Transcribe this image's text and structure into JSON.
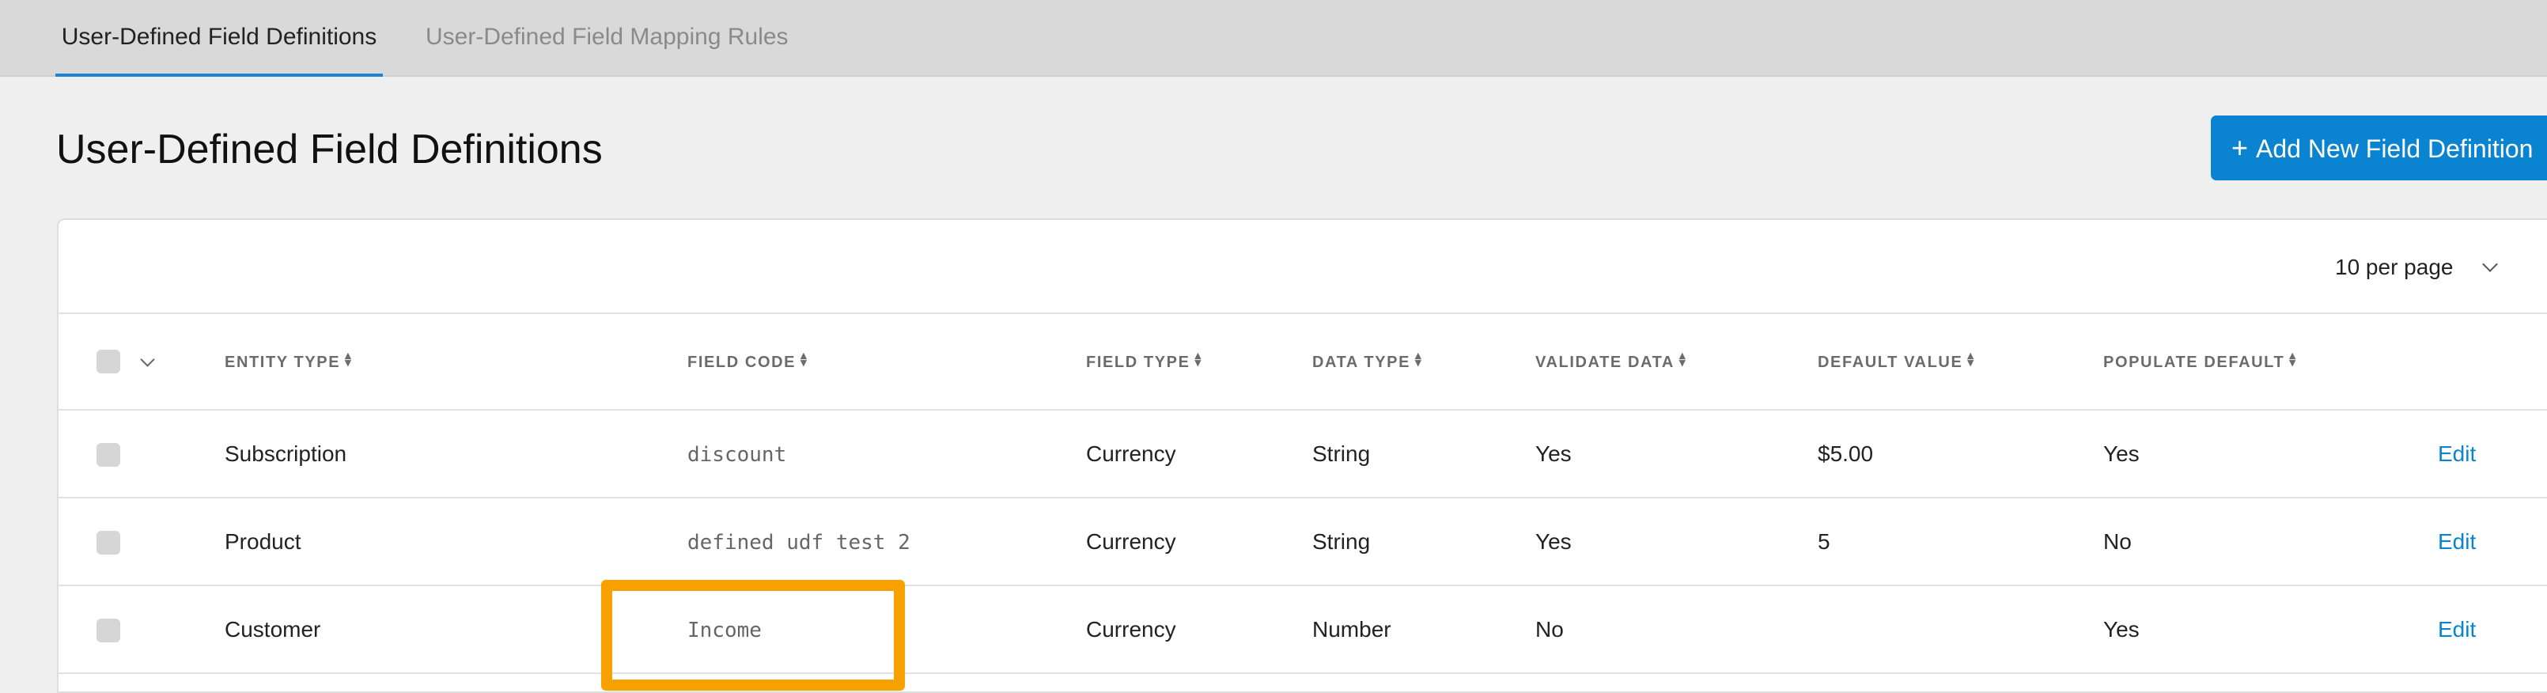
{
  "tabs": [
    {
      "label": "User-Defined Field Definitions",
      "active": true
    },
    {
      "label": "User-Defined Field Mapping Rules",
      "active": false
    }
  ],
  "page": {
    "title": "User-Defined Field Definitions",
    "add_button_label": "Add New Field Definition"
  },
  "pagination": {
    "per_page_label": "10 per page"
  },
  "table": {
    "columns": [
      "ENTITY TYPE",
      "FIELD CODE",
      "FIELD TYPE",
      "DATA TYPE",
      "VALIDATE DATA",
      "DEFAULT VALUE",
      "POPULATE DEFAULT"
    ],
    "rows": [
      {
        "entity_type": "Subscription",
        "field_code": "discount",
        "field_type": "Currency",
        "data_type": "String",
        "validate_data": "Yes",
        "default_value": "$5.00",
        "populate_default": "Yes",
        "action": "Edit"
      },
      {
        "entity_type": "Product",
        "field_code": "defined udf test 2",
        "field_type": "Currency",
        "data_type": "String",
        "validate_data": "Yes",
        "default_value": "5",
        "populate_default": "No",
        "action": "Edit"
      },
      {
        "entity_type": "Customer",
        "field_code": "Income",
        "field_type": "Currency",
        "data_type": "Number",
        "validate_data": "No",
        "default_value": "",
        "populate_default": "Yes",
        "action": "Edit"
      }
    ]
  },
  "colors": {
    "accent": "#0a84d0",
    "highlight": "#f6a100",
    "tab_underline": "#1f84d6"
  },
  "icons": {
    "add": "plus-icon",
    "per_page": "chevron-down-icon",
    "sort": "sort-arrows-icon"
  }
}
